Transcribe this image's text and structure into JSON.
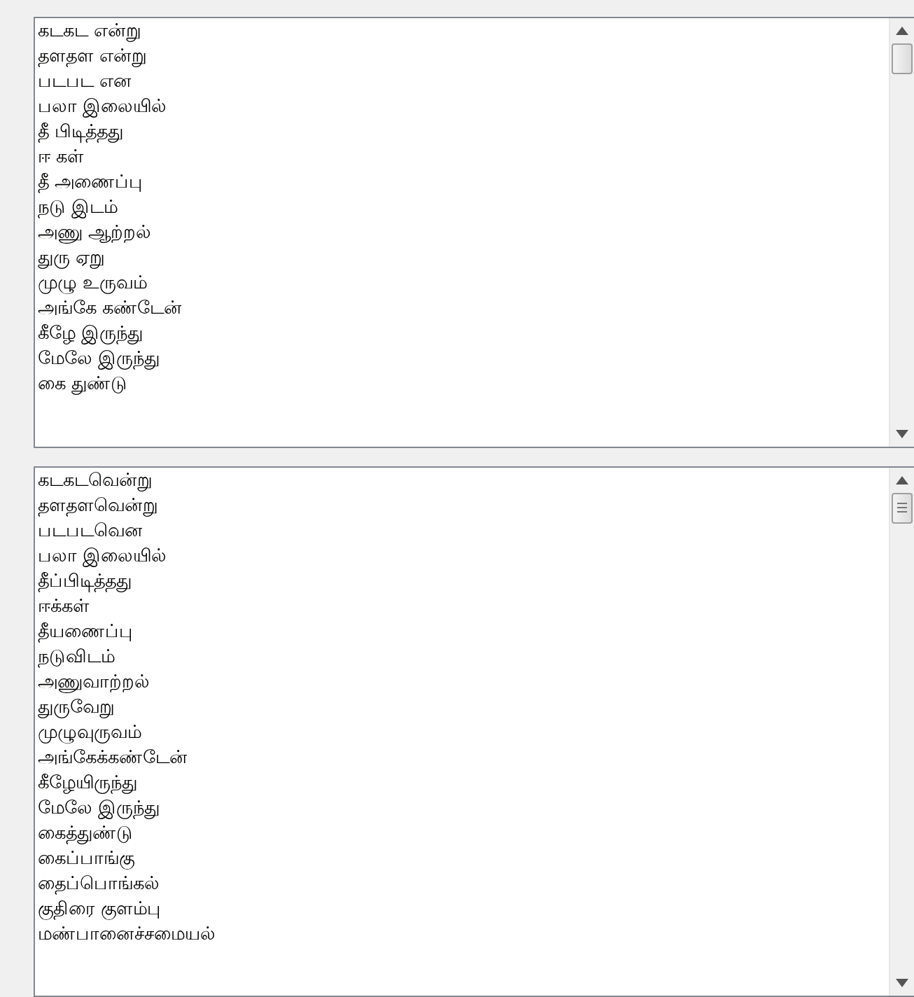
{
  "text_boxes": [
    {
      "lines": [
        "கடகட என்று",
        "தளதள என்று",
        "படபட என",
        "பலா இலையில்",
        "தீ பிடித்தது",
        "ஈ கள்",
        "தீ அணைப்பு",
        "நடு இடம்",
        "அணு ஆற்றல்",
        "துரு ஏறு",
        "முழு உருவம்",
        "அங்கே கண்டேன்",
        "கீழே இருந்து",
        "மேலே இருந்து",
        "கை துண்டு"
      ]
    },
    {
      "lines": [
        "கடகடவென்று",
        "தளதளவென்று",
        "படபடவென",
        "பலா இலையில்",
        "தீப்பிடித்தது",
        "ஈக்கள்",
        "தீயணைப்பு",
        "நடுவிடம்",
        "அணுவாற்றல்",
        "துருவேறு",
        "முழுவுருவம்",
        "அங்கேக்கண்டேன்",
        "கீழேயிருந்து",
        "மேலே இருந்து",
        "கைத்துண்டு",
        "கைப்பாங்கு",
        "தைப்பொங்கல்",
        "குதிரை குளம்பு",
        "மண்பானைச்சமையல்"
      ]
    }
  ]
}
